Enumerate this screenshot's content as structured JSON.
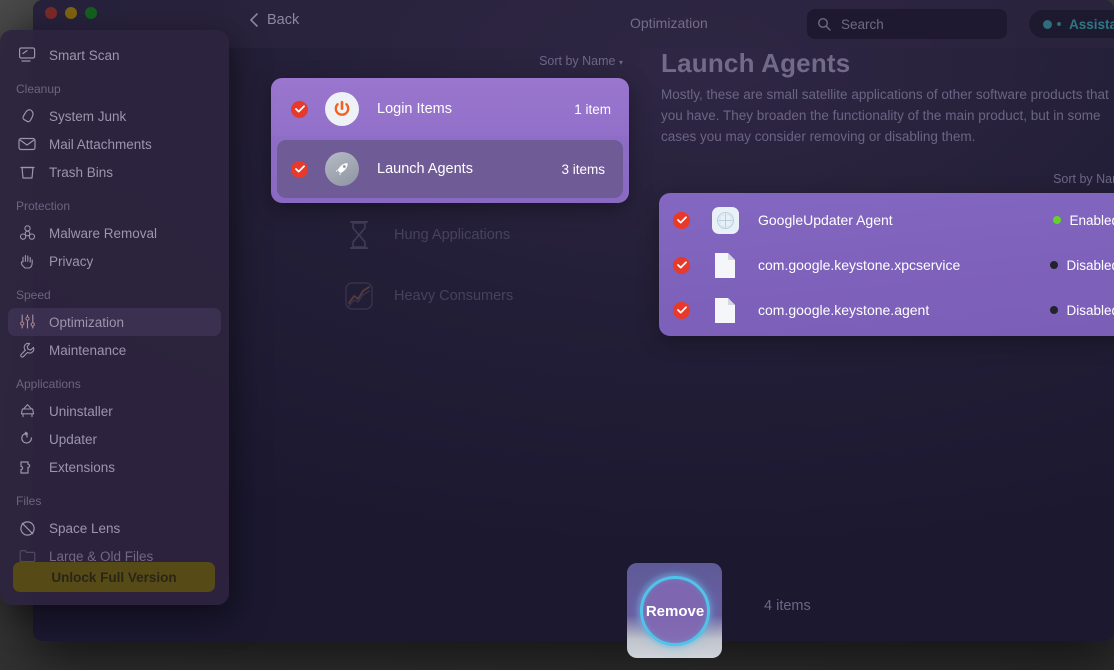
{
  "window": {
    "traffic_lights": [
      "close",
      "minimize",
      "zoom"
    ],
    "back_label": "Back",
    "breadcrumb": "Optimization",
    "search_placeholder": "Search",
    "assistant_label": "Assistant",
    "assistant_color": "#2f7784"
  },
  "sidebar": {
    "top_item": {
      "label": "Smart Scan",
      "icon": "monitor-scan-icon"
    },
    "groups": [
      {
        "title": "Cleanup",
        "items": [
          {
            "label": "System Junk",
            "icon": "broom-icon",
            "faded": false
          },
          {
            "label": "Mail Attachments",
            "icon": "envelope-icon",
            "faded": false
          },
          {
            "label": "Trash Bins",
            "icon": "trash-icon",
            "faded": false
          }
        ]
      },
      {
        "title": "Protection",
        "items": [
          {
            "label": "Malware Removal",
            "icon": "biohazard-icon",
            "faded": false
          },
          {
            "label": "Privacy",
            "icon": "hand-icon",
            "faded": false
          }
        ]
      },
      {
        "title": "Speed",
        "items": [
          {
            "label": "Optimization",
            "icon": "sliders-icon",
            "faded": false,
            "active": true
          },
          {
            "label": "Maintenance",
            "icon": "wrench-icon",
            "faded": false
          }
        ]
      },
      {
        "title": "Applications",
        "items": [
          {
            "label": "Uninstaller",
            "icon": "uninstall-icon",
            "faded": false
          },
          {
            "label": "Updater",
            "icon": "refresh-icon",
            "faded": false
          },
          {
            "label": "Extensions",
            "icon": "puzzle-icon",
            "faded": false
          }
        ]
      },
      {
        "title": "Files",
        "items": [
          {
            "label": "Space Lens",
            "icon": "space-lens-icon",
            "faded": false
          },
          {
            "label": "Large & Old Files",
            "icon": "folder-icon",
            "faded": true
          }
        ]
      }
    ],
    "unlock_label": "Unlock Full Version",
    "unlock_color": "#564a16"
  },
  "middle": {
    "sort_label": "Sort by Name",
    "selected_rows": [
      {
        "label": "Login Items",
        "count": "1 item",
        "icon": "power-icon",
        "checked": true,
        "selected": false
      },
      {
        "label": "Launch Agents",
        "count": "3 items",
        "icon": "rocket-icon",
        "checked": true,
        "selected": true
      }
    ],
    "dim_rows": [
      {
        "label": "Hung Applications",
        "icon": "hourglass-icon"
      },
      {
        "label": "Heavy Consumers",
        "icon": "chart-icon"
      }
    ]
  },
  "detail": {
    "title": "Launch Agents",
    "description": "Mostly, these are small satellite applications of other software products that you have. They broaden the functionality of the main product, but in some cases you may consider removing or disabling them.",
    "sort_label": "Sort by Name",
    "status_colors": {
      "enabled": "#64d329",
      "disabled": "#23232b"
    },
    "rows": [
      {
        "name": "GoogleUpdater Agent",
        "status": "Enabled",
        "state": "enabled",
        "icon": "app-grid-icon",
        "checked": true
      },
      {
        "name": "com.google.keystone.xpcservice",
        "status": "Disabled",
        "state": "disabled",
        "icon": "document-icon",
        "checked": true
      },
      {
        "name": "com.google.keystone.agent",
        "status": "Disabled",
        "state": "disabled",
        "icon": "document-icon",
        "checked": true
      }
    ]
  },
  "footer": {
    "remove_label": "Remove",
    "items_count": "4 items",
    "focus_ring_color": "#4fc3e8"
  }
}
